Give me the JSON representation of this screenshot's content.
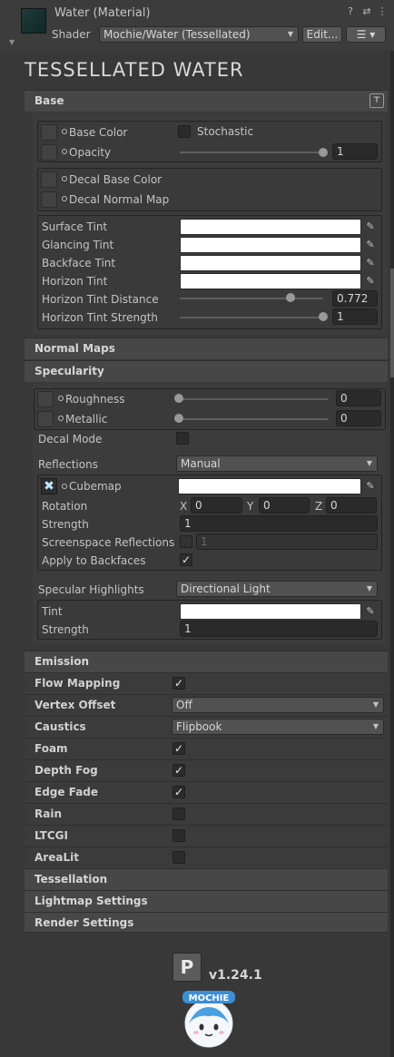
{
  "header": {
    "title": "Water (Material)",
    "shader_label": "Shader",
    "shader_value": "Mochie/Water (Tessellated)",
    "edit_label": "Edit...",
    "help_icon": "?",
    "settings_icon": "⇄",
    "more_icon": "⋮"
  },
  "main_title": "TESSELLATED WATER",
  "base": {
    "title": "Base",
    "base_color": "Base Color",
    "stochastic": "Stochastic",
    "opacity": "Opacity",
    "opacity_value": "1",
    "opacity_level": 1.0,
    "decal_base_color": "Decal Base Color",
    "decal_normal_map": "Decal Normal Map",
    "surface_tint": "Surface Tint",
    "glancing_tint": "Glancing Tint",
    "backface_tint": "Backface Tint",
    "horizon_tint": "Horizon Tint",
    "horizon_tint_distance": "Horizon Tint Distance",
    "horizon_tint_distance_value": "0.772",
    "horizon_tint_distance_level": 0.772,
    "horizon_tint_strength": "Horizon Tint Strength",
    "horizon_tint_strength_value": "1",
    "horizon_tint_strength_level": 1.0
  },
  "normal_maps": {
    "title": "Normal Maps"
  },
  "specularity": {
    "title": "Specularity",
    "roughness": "Roughness",
    "roughness_value": "0",
    "metallic": "Metallic",
    "metallic_value": "0",
    "decal_mode": "Decal Mode",
    "reflections": "Reflections",
    "reflections_value": "Manual",
    "cubemap": "Cubemap",
    "rotation": "Rotation",
    "rot_x_label": "X",
    "rot_x": "0",
    "rot_y_label": "Y",
    "rot_y": "0",
    "rot_z_label": "Z",
    "rot_z": "0",
    "strength": "Strength",
    "strength_value": "1",
    "ssr": "Screenspace Reflections",
    "ssr_value": "1",
    "apply_backfaces": "Apply to Backfaces",
    "specular_highlights": "Specular Highlights",
    "specular_highlights_value": "Directional Light",
    "tint": "Tint",
    "highlight_strength": "Strength",
    "highlight_strength_value": "1"
  },
  "rows": {
    "emission": "Emission",
    "flow_mapping": "Flow Mapping",
    "vertex_offset": "Vertex Offset",
    "vertex_offset_value": "Off",
    "caustics": "Caustics",
    "caustics_value": "Flipbook",
    "foam": "Foam",
    "depth_fog": "Depth Fog",
    "edge_fade": "Edge Fade",
    "rain": "Rain",
    "ltcgi": "LTCGI",
    "arealit": "AreaLit",
    "tessellation": "Tessellation",
    "lightmap_settings": "Lightmap Settings",
    "render_settings": "Render Settings"
  },
  "footer": {
    "version": "v1.24.1",
    "logo_letter": "P",
    "mascot_text": "MOCHIE"
  },
  "check_mark": "✓"
}
